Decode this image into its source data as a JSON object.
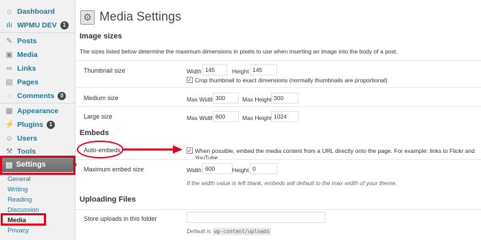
{
  "sidebar": {
    "top_items": [
      {
        "label": "Dashboard",
        "icon": "home-icon"
      },
      {
        "label": "WPMU DEV",
        "icon": "wpmudev-icon",
        "badge": "1"
      }
    ],
    "items": [
      {
        "label": "Posts",
        "icon": "pin-icon"
      },
      {
        "label": "Media",
        "icon": "media-icon"
      },
      {
        "label": "Links",
        "icon": "link-icon"
      },
      {
        "label": "Pages",
        "icon": "page-icon"
      },
      {
        "label": "Comments",
        "icon": "comment-icon",
        "badge": "0"
      },
      {
        "label": "Appearance",
        "icon": "appearance-icon"
      },
      {
        "label": "Plugins",
        "icon": "plugin-icon",
        "badge": "1"
      },
      {
        "label": "Users",
        "icon": "users-icon"
      },
      {
        "label": "Tools",
        "icon": "tools-icon"
      }
    ],
    "active_item": {
      "label": "Settings",
      "icon": "settings-icon"
    },
    "submenu": [
      "General",
      "Writing",
      "Reading",
      "Discussion",
      "Media",
      "Privacy"
    ],
    "current_submenu": "Media"
  },
  "page": {
    "title": "Media Settings",
    "image_sizes": {
      "heading": "Image sizes",
      "description": "The sizes listed below determine the maximum dimensions in pixels to use when inserting an image into the body of a post.",
      "thumbnail": {
        "label": "Thumbnail size",
        "width_label": "Width",
        "width": "145",
        "height_label": "Height",
        "height": "145",
        "crop_checked": true,
        "crop_label": "Crop thumbnail to exact dimensions (normally thumbnails are proportional)"
      },
      "medium": {
        "label": "Medium size",
        "max_width_label": "Max Width",
        "max_width": "300",
        "max_height_label": "Max Height",
        "max_height": "300"
      },
      "large": {
        "label": "Large size",
        "max_width_label": "Max Width",
        "max_width": "600",
        "max_height_label": "Max Height",
        "max_height": "1024"
      }
    },
    "embeds": {
      "heading": "Embeds",
      "auto_embeds": {
        "label": "Auto-embeds",
        "checked": true,
        "text": "When possible, embed the media content from a URL directly onto the page. For example: links to Flickr and YouTube."
      },
      "max_embed": {
        "label": "Maximum embed size",
        "width_label": "Width",
        "width": "600",
        "height_label": "Height",
        "height": "0",
        "help": "If the width value is left blank, embeds will default to the max width of your theme."
      }
    },
    "uploading": {
      "heading": "Uploading Files",
      "store_label": "Store uploads in this folder",
      "store_value": "",
      "default_prefix": "Default is",
      "default_path": "wp-content/uploads"
    }
  },
  "colors": {
    "annotation_red": "#e3001b",
    "link_blue": "#21759b",
    "active_menu_gray": "#6d6d6d"
  }
}
